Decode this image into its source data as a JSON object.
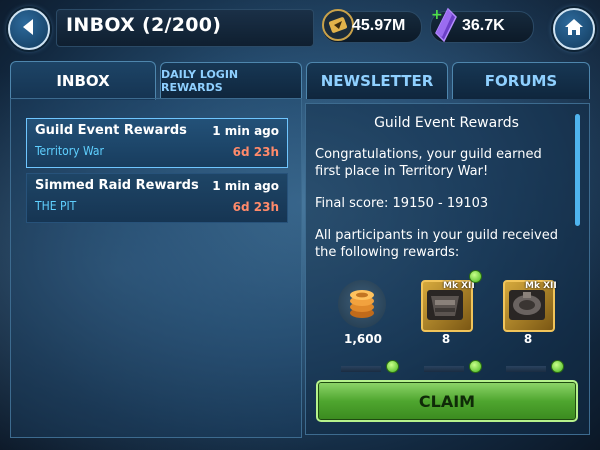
{
  "header": {
    "title": "INBOX (2/200)",
    "credits": "45.97M",
    "crystals": "36.7K"
  },
  "tabs": [
    {
      "label": "INBOX",
      "active": true
    },
    {
      "label": "DAILY LOGIN REWARDS",
      "active": false
    },
    {
      "label": "NEWSLETTER",
      "active": false
    },
    {
      "label": "FORUMS",
      "active": false
    }
  ],
  "mail": [
    {
      "title": "Guild Event Rewards",
      "subtitle": "Territory War",
      "time": "1 min ago",
      "expires": "6d 23h",
      "selected": true
    },
    {
      "title": "Simmed Raid Rewards",
      "subtitle": "THE PIT",
      "time": "1 min ago",
      "expires": "6d 23h",
      "selected": false
    }
  ],
  "detail": {
    "title": "Guild Event Rewards",
    "paragraphs": [
      "Congratulations, your guild earned first place in Territory War!",
      "Final score: 19150 - 19103",
      "All participants in your guild received the following rewards:"
    ],
    "rewards": [
      {
        "icon": "credits-icon",
        "label": "",
        "count": "1,600"
      },
      {
        "icon": "mk-xii-gear-icon",
        "label": "Mk XII",
        "count": "8"
      },
      {
        "icon": "mk-xii-gear-icon",
        "label": "Mk XII",
        "count": "8"
      }
    ],
    "claim_label": "CLAIM"
  },
  "colors": {
    "accent": "#5fd0ff",
    "expire": "#ff8a6a",
    "claim": "#4fa62f"
  }
}
